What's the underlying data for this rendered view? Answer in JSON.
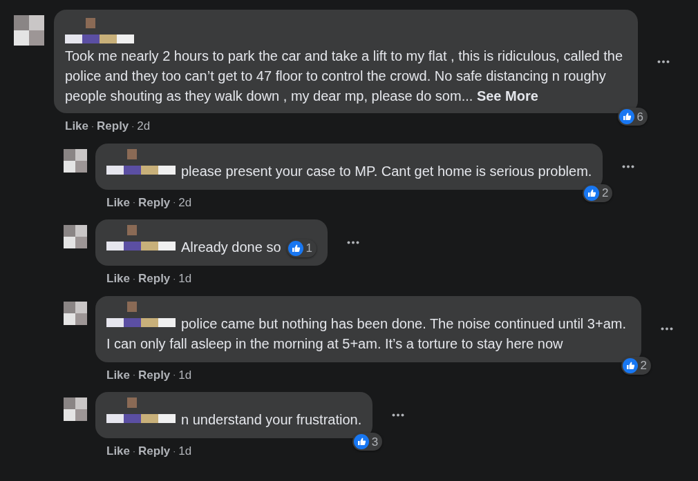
{
  "comments": [
    {
      "kind": "comment",
      "text": "Took me nearly 2 hours to park the car and take a lift to my flat , this is ridiculous, called the police and they too can’t get to 47 floor to control the crowd. No safe distancing n roughy people shouting as they walk down , my dear mp, please do som...",
      "see_more": "See More",
      "reaction_count": "6",
      "actions": [
        "Like",
        "Reply"
      ],
      "separator": "·",
      "time": "2d",
      "children": [
        {
          "kind": "reply",
          "text": "please present your case to MP. Cant get home is serious problem.",
          "reaction_count": "2",
          "actions": [
            "Like",
            "Reply"
          ],
          "separator": "·",
          "time": "2d"
        },
        {
          "kind": "short_reply",
          "text": "Already done so",
          "reaction_count": "1",
          "actions": [
            "Like",
            "Reply"
          ],
          "separator": "·",
          "time": "1d"
        },
        {
          "kind": "reply",
          "text": "police came but nothing has been done. The noise continued until 3+am. I can only fall asleep in the morning at 5+am. It’s a torture to stay here now",
          "reaction_count": "2",
          "actions": [
            "Like",
            "Reply"
          ],
          "separator": "·",
          "time": "1d"
        },
        {
          "kind": "reply",
          "text": "n understand your frustration.",
          "reaction_count": "3",
          "actions": [
            "Like",
            "Reply"
          ],
          "separator": "·",
          "time": "1d"
        }
      ]
    }
  ]
}
